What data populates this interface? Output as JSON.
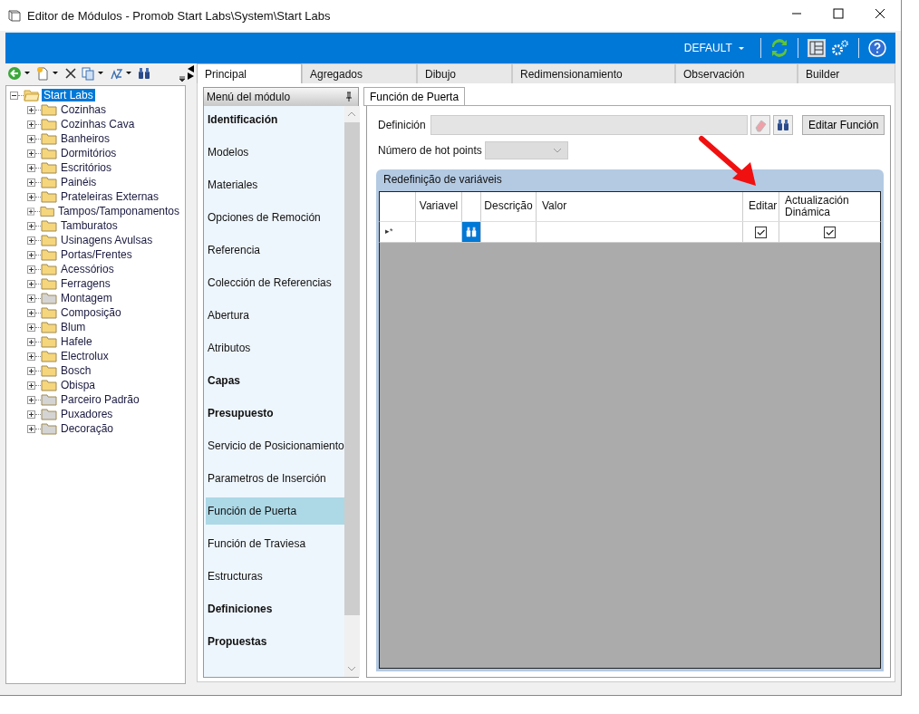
{
  "window": {
    "title": "Editor de Módulos - Promob Start Labs\\System\\Start Labs"
  },
  "topbar": {
    "profile": "DEFAULT"
  },
  "tree": {
    "label": "Start Labs",
    "selected": true,
    "expanded": true,
    "children": [
      {
        "label": "Cozinhas",
        "color": "#f6d67c"
      },
      {
        "label": "Cozinhas Cava",
        "color": "#f6d67c"
      },
      {
        "label": "Banheiros",
        "color": "#f6d67c"
      },
      {
        "label": "Dormitórios",
        "color": "#f6d67c"
      },
      {
        "label": "Escritórios",
        "color": "#f6d67c"
      },
      {
        "label": "Painéis",
        "color": "#f6d67c"
      },
      {
        "label": "Prateleiras Externas",
        "color": "#f6d67c"
      },
      {
        "label": "Tampos/Tamponamentos",
        "color": "#f6d67c"
      },
      {
        "label": "Tamburatos",
        "color": "#f6d67c"
      },
      {
        "label": "Usinagens Avulsas",
        "color": "#f6d67c"
      },
      {
        "label": "Portas/Frentes",
        "color": "#f6d67c"
      },
      {
        "label": "Acessórios",
        "color": "#f6d67c"
      },
      {
        "label": "Ferragens",
        "color": "#f6d67c"
      },
      {
        "label": "Montagem",
        "color": "#d4d4d4"
      },
      {
        "label": "Composição",
        "color": "#f6d67c"
      },
      {
        "label": "Blum",
        "color": "#f6d67c"
      },
      {
        "label": "Hafele",
        "color": "#f6d67c"
      },
      {
        "label": "Electrolux",
        "color": "#f6d67c"
      },
      {
        "label": "Bosch",
        "color": "#f6d67c"
      },
      {
        "label": "Obispa",
        "color": "#f6d67c"
      },
      {
        "label": "Parceiro Padrão",
        "color": "#d4d4d4"
      },
      {
        "label": "Puxadores",
        "color": "#d4d4d4"
      },
      {
        "label": "Decoração",
        "color": "#d4d4d4"
      }
    ]
  },
  "tabs": [
    {
      "label": "Principal",
      "selected": true
    },
    {
      "label": "Agregados",
      "selected": false
    },
    {
      "label": "Dibujo",
      "selected": false
    },
    {
      "label": "Redimensionamiento",
      "selected": false
    },
    {
      "label": "Observación",
      "selected": false
    },
    {
      "label": "Builder",
      "selected": false
    }
  ],
  "module_menu": {
    "title": "Menú del módulo",
    "items": [
      {
        "label": "Identificación",
        "bold": true,
        "selected": false
      },
      {
        "label": "Modelos",
        "bold": false,
        "selected": false
      },
      {
        "label": "Materiales",
        "bold": false,
        "selected": false
      },
      {
        "label": "Opciones de Remoción",
        "bold": false,
        "selected": false
      },
      {
        "label": "Referencia",
        "bold": false,
        "selected": false
      },
      {
        "label": "Colección de Referencias",
        "bold": false,
        "selected": false
      },
      {
        "label": "Abertura",
        "bold": false,
        "selected": false
      },
      {
        "label": "Atributos",
        "bold": false,
        "selected": false
      },
      {
        "label": "Capas",
        "bold": true,
        "selected": false
      },
      {
        "label": "Presupuesto",
        "bold": true,
        "selected": false
      },
      {
        "label": "Servicio de Posicionamiento",
        "bold": false,
        "selected": false
      },
      {
        "label": "Parametros de Inserción",
        "bold": false,
        "selected": false
      },
      {
        "label": "Función de Puerta",
        "bold": false,
        "selected": true
      },
      {
        "label": "Función de Traviesa",
        "bold": false,
        "selected": false
      },
      {
        "label": "Estructuras",
        "bold": false,
        "selected": false
      },
      {
        "label": "Definiciones",
        "bold": true,
        "selected": false
      },
      {
        "label": "Propuestas",
        "bold": true,
        "selected": false
      }
    ]
  },
  "panel": {
    "tab": "Función de Puerta",
    "definition_label": "Definición",
    "edit_button": "Editar Función",
    "hotpoints_label": "Número de hot points",
    "group_title": "Redefinição de variáveis",
    "columns": [
      "Variavel",
      "Descrição",
      "Valor",
      "Editar",
      "Actualización Dinámica"
    ],
    "new_row": {
      "marker": "▸*",
      "editar": true,
      "dinamica": true
    }
  }
}
